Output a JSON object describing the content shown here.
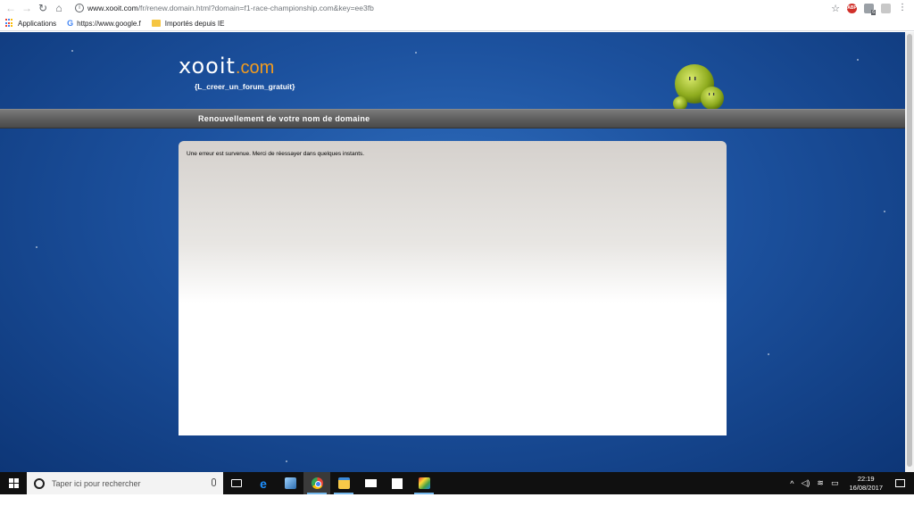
{
  "browser": {
    "url_host": "www.xooit.com",
    "url_path": "/fr/renew.domain.html?domain=f1-race-championship.com&key=ee3fb",
    "bookmarks": [
      {
        "label": "Applications",
        "icon": "apps-grid-icon"
      },
      {
        "label": "https://www.google.f",
        "icon": "google-icon"
      },
      {
        "label": "Importés depuis IE",
        "icon": "folder-icon"
      }
    ],
    "extension_badge": "6",
    "abp_label": "ABP"
  },
  "header": {
    "logo_text": "xooit",
    "logo_suffix": ".com",
    "tagline": "{L_creer_un_forum_gratuit}",
    "title": "Renouvellement de votre nom de domaine"
  },
  "content": {
    "message": "Une erreur est survenue. Merci de réessayer dans quelques instants."
  },
  "taskbar": {
    "search_placeholder": "Taper ici pour rechercher",
    "time": "22:19",
    "date": "16/08/2017"
  },
  "colors": {
    "page_blue": "#1c519e",
    "logo_orange": "#f39c1f",
    "title_bar_gray": "#5a5a5a"
  }
}
